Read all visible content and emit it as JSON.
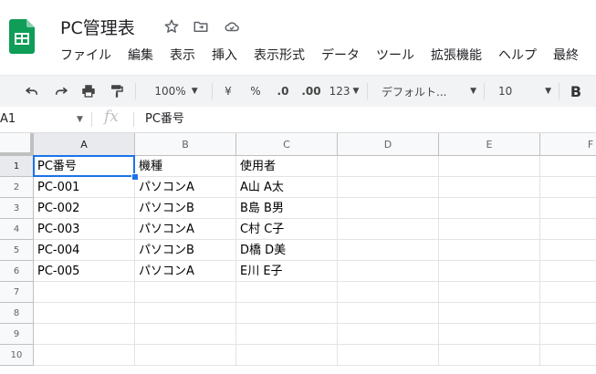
{
  "app": {
    "doc_title": "PC管理表",
    "menu": [
      "ファイル",
      "編集",
      "表示",
      "挿入",
      "表示形式",
      "データ",
      "ツール",
      "拡張機能",
      "ヘルプ",
      "最終"
    ]
  },
  "toolbar": {
    "zoom": "100%",
    "currency": "¥",
    "percent": "%",
    "dec_decrease": ".0",
    "dec_increase": ".00",
    "more_formats": "123",
    "font": "デフォルト...",
    "font_size": "10",
    "bold": "B"
  },
  "formula_bar": {
    "cell_ref": "A1",
    "fx": "fx",
    "value": "PC番号"
  },
  "sheet": {
    "columns": [
      "A",
      "B",
      "C",
      "D",
      "E",
      "F"
    ],
    "rows": [
      "1",
      "2",
      "3",
      "4",
      "5",
      "6",
      "7",
      "8",
      "9",
      "10"
    ],
    "cells": [
      [
        "PC番号",
        "機種",
        "使用者"
      ],
      [
        "PC-001",
        "パソコンA",
        "A山 A太"
      ],
      [
        "PC-002",
        "パソコンB",
        "B島 B男"
      ],
      [
        "PC-003",
        "パソコンA",
        "C村 C子"
      ],
      [
        "PC-004",
        "パソコンB",
        "D橋 D美"
      ],
      [
        "PC-005",
        "パソコンA",
        "E川 E子"
      ]
    ]
  },
  "colors": {
    "accent": "#1a73e8",
    "sheets_green": "#0f9d58"
  }
}
